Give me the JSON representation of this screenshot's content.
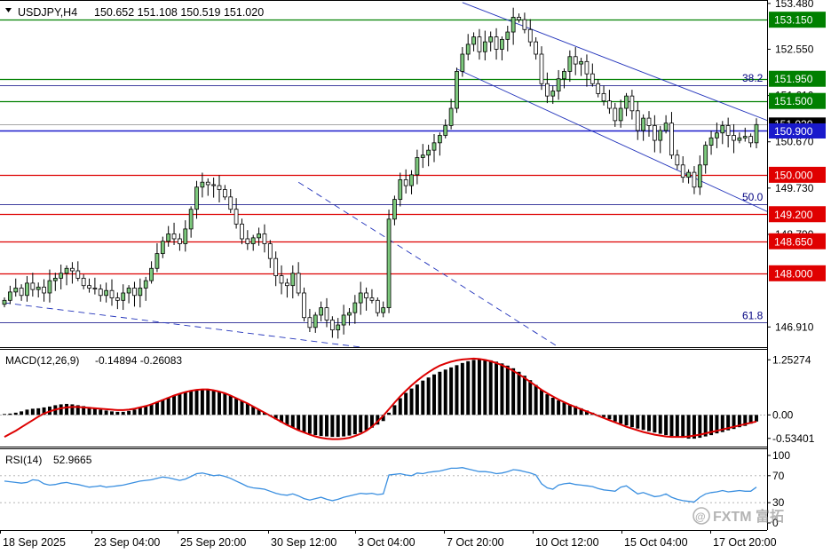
{
  "header": {
    "symbol": "USDJPY,H4",
    "ohlc": "150.652 151.108 150.519 151.020"
  },
  "macd_header": {
    "label": "MACD(12,26,9)",
    "values": "-0.14894 -0.26083"
  },
  "rsi_header": {
    "label": "RSI(14)",
    "value": "52.9665"
  },
  "watermark": "FXTM 富拓",
  "colors": {
    "candle_up_body": "#7dc97d",
    "candle_down_body": "#ffffff",
    "candle_outline": "#000000",
    "support_line": "#dd0000",
    "resistance_line": "#008000",
    "fib_line": "#000080",
    "channel": "#2233bb",
    "macd_signal": "#dd0000",
    "rsi_line": "#3a8fe0",
    "current_price": "#1a1acc"
  },
  "chart_data": [
    {
      "type": "candlestick",
      "title": "USDJPY,H4",
      "ylim": [
        146.5,
        153.55
      ],
      "y_axis_ticks": [
        "153.480",
        "152.550",
        "151.610",
        "150.670",
        "149.730",
        "148.790",
        "146.910"
      ],
      "x_axis_ticks": [
        "18 Sep 2025",
        "23 Sep 04:00",
        "25 Sep 20:00",
        "30 Sep 12:00",
        "3 Oct 04:00",
        "7 Oct 20:00",
        "10 Oct 12:00",
        "15 Oct 04:00",
        "17 Oct 20:00"
      ],
      "closes": [
        147.45,
        147.62,
        147.7,
        147.55,
        147.8,
        147.67,
        147.72,
        147.6,
        147.85,
        147.9,
        148.0,
        148.1,
        148.05,
        147.9,
        147.75,
        147.7,
        147.68,
        147.55,
        147.65,
        147.5,
        147.45,
        147.6,
        147.7,
        147.55,
        147.7,
        147.85,
        148.1,
        148.4,
        148.65,
        148.8,
        148.7,
        148.6,
        148.9,
        149.3,
        149.75,
        149.85,
        149.8,
        149.78,
        149.7,
        149.55,
        149.3,
        149.0,
        148.7,
        148.6,
        148.72,
        148.8,
        148.6,
        148.3,
        147.95,
        147.8,
        147.75,
        148.0,
        147.6,
        147.1,
        146.9,
        147.15,
        147.3,
        147.05,
        146.85,
        146.95,
        147.15,
        147.2,
        147.4,
        147.6,
        147.5,
        147.45,
        147.2,
        147.3,
        149.1,
        149.5,
        149.9,
        149.78,
        150.0,
        150.35,
        150.4,
        150.5,
        150.65,
        150.8,
        151.0,
        151.35,
        152.1,
        152.45,
        152.65,
        152.8,
        152.5,
        152.7,
        152.8,
        152.55,
        152.75,
        152.9,
        153.2,
        153.15,
        152.95,
        152.7,
        152.45,
        151.85,
        151.6,
        151.7,
        151.95,
        152.1,
        152.4,
        152.25,
        152.3,
        152.05,
        151.85,
        151.65,
        151.5,
        151.35,
        151.1,
        151.35,
        151.6,
        151.3,
        150.9,
        151.15,
        151.0,
        150.7,
        150.9,
        151.05,
        150.4,
        150.2,
        149.95,
        150.05,
        149.75,
        150.2,
        150.6,
        150.75,
        150.85,
        151.0,
        150.8,
        150.7,
        150.75,
        150.78,
        150.65,
        151.02
      ]
    },
    {
      "type": "bar",
      "title": "MACD(12,26,9)",
      "values": [
        0.02,
        0.03,
        0.05,
        0.08,
        0.12,
        0.14,
        0.15,
        0.17,
        0.19,
        0.22,
        0.24,
        0.25,
        0.24,
        0.22,
        0.2,
        0.18,
        0.15,
        0.12,
        0.1,
        0.08,
        0.07,
        0.07,
        0.09,
        0.12,
        0.16,
        0.2,
        0.25,
        0.3,
        0.35,
        0.4,
        0.44,
        0.48,
        0.52,
        0.55,
        0.57,
        0.58,
        0.58,
        0.56,
        0.53,
        0.49,
        0.44,
        0.38,
        0.32,
        0.26,
        0.19,
        0.12,
        0.05,
        -0.02,
        -0.1,
        -0.17,
        -0.23,
        -0.29,
        -0.34,
        -0.39,
        -0.43,
        -0.46,
        -0.48,
        -0.49,
        -0.5,
        -0.5,
        -0.49,
        -0.47,
        -0.44,
        -0.4,
        -0.35,
        -0.29,
        -0.22,
        -0.14,
        0.05,
        0.22,
        0.38,
        0.5,
        0.6,
        0.69,
        0.78,
        0.85,
        0.92,
        0.98,
        1.03,
        1.08,
        1.13,
        1.18,
        1.22,
        1.25,
        1.26,
        1.26,
        1.24,
        1.21,
        1.17,
        1.12,
        1.06,
        0.98,
        0.89,
        0.79,
        0.68,
        0.57,
        0.47,
        0.39,
        0.33,
        0.28,
        0.24,
        0.2,
        0.15,
        0.1,
        0.05,
        0.0,
        -0.05,
        -0.1,
        -0.15,
        -0.2,
        -0.24,
        -0.28,
        -0.31,
        -0.34,
        -0.37,
        -0.4,
        -0.43,
        -0.46,
        -0.48,
        -0.5,
        -0.52,
        -0.54,
        -0.54,
        -0.52,
        -0.49,
        -0.46,
        -0.42,
        -0.39,
        -0.35,
        -0.32,
        -0.28,
        -0.25,
        -0.2,
        -0.15
      ],
      "signal": [
        -0.5,
        -0.43,
        -0.36,
        -0.28,
        -0.2,
        -0.12,
        -0.04,
        0.03,
        0.08,
        0.12,
        0.15,
        0.17,
        0.18,
        0.18,
        0.17,
        0.16,
        0.15,
        0.14,
        0.13,
        0.12,
        0.11,
        0.11,
        0.12,
        0.14,
        0.17,
        0.2,
        0.24,
        0.29,
        0.34,
        0.39,
        0.44,
        0.48,
        0.52,
        0.55,
        0.57,
        0.58,
        0.58,
        0.56,
        0.53,
        0.49,
        0.44,
        0.38,
        0.32,
        0.26,
        0.19,
        0.12,
        0.05,
        -0.02,
        -0.09,
        -0.16,
        -0.23,
        -0.29,
        -0.35,
        -0.4,
        -0.45,
        -0.49,
        -0.52,
        -0.54,
        -0.55,
        -0.55,
        -0.54,
        -0.52,
        -0.48,
        -0.43,
        -0.36,
        -0.27,
        -0.15,
        -0.02,
        0.13,
        0.28,
        0.42,
        0.55,
        0.67,
        0.78,
        0.88,
        0.97,
        1.05,
        1.12,
        1.17,
        1.21,
        1.24,
        1.26,
        1.27,
        1.28,
        1.27,
        1.25,
        1.22,
        1.18,
        1.13,
        1.07,
        1.0,
        0.92,
        0.84,
        0.75,
        0.66,
        0.57,
        0.49,
        0.42,
        0.35,
        0.29,
        0.23,
        0.18,
        0.13,
        0.08,
        0.03,
        -0.02,
        -0.07,
        -0.12,
        -0.17,
        -0.22,
        -0.27,
        -0.31,
        -0.35,
        -0.39,
        -0.42,
        -0.45,
        -0.47,
        -0.49,
        -0.5,
        -0.5,
        -0.5,
        -0.49,
        -0.47,
        -0.45,
        -0.42,
        -0.39,
        -0.36,
        -0.33,
        -0.3,
        -0.27,
        -0.24,
        -0.21,
        -0.18,
        -0.15
      ],
      "ylim": [
        -0.72,
        1.5
      ],
      "y_axis_ticks": [
        "1.25274",
        "0.00",
        "-0.53401"
      ]
    },
    {
      "type": "line",
      "title": "RSI(14)",
      "values": [
        62,
        61,
        60,
        59,
        60,
        64,
        63,
        58,
        56,
        57,
        59,
        60,
        58,
        57,
        55,
        53,
        54,
        55,
        53,
        54,
        55,
        56,
        58,
        60,
        62,
        63,
        64,
        66,
        68,
        67,
        65,
        63,
        65,
        69,
        73,
        74,
        72,
        70,
        71,
        69,
        66,
        62,
        58,
        54,
        52,
        51,
        50,
        47,
        44,
        42,
        41,
        43,
        40,
        36,
        34,
        36,
        38,
        35,
        33,
        35,
        38,
        40,
        42,
        44,
        43,
        44,
        42,
        43,
        71,
        72,
        73,
        71,
        70,
        74,
        73,
        75,
        76,
        77,
        79,
        81,
        81,
        82,
        80,
        78,
        76,
        76,
        75,
        73,
        74,
        76,
        79,
        78,
        76,
        74,
        71,
        58,
        52,
        50,
        56,
        58,
        59,
        57,
        56,
        55,
        54,
        51,
        49,
        48,
        47,
        53,
        55,
        49,
        43,
        45,
        42,
        39,
        40,
        43,
        38,
        35,
        33,
        32,
        31,
        38,
        43,
        45,
        46,
        48,
        46,
        47,
        48,
        47,
        47,
        53
      ],
      "ylim": [
        0,
        100
      ],
      "y_axis_ticks": [
        "100",
        "70",
        "30",
        "0"
      ]
    }
  ],
  "annotations": {
    "price_labels": [
      {
        "text": "153.150",
        "kind": "resistance",
        "value": 153.15
      },
      {
        "text": "151.950",
        "kind": "resistance",
        "value": 151.95
      },
      {
        "text": "151.500",
        "kind": "resistance",
        "value": 151.5
      },
      {
        "text": "150.900",
        "kind": "current",
        "value": 150.9
      },
      {
        "text": "150.000",
        "kind": "support",
        "value": 150.0
      },
      {
        "text": "149.200",
        "kind": "support",
        "value": 149.2
      },
      {
        "text": "148.650",
        "kind": "support",
        "value": 148.65
      },
      {
        "text": "148.000",
        "kind": "support",
        "value": 148.0
      }
    ],
    "fib_labels": [
      {
        "text": "38.2",
        "value": 151.82
      },
      {
        "text": "50.0",
        "value": 149.4
      },
      {
        "text": "61.8",
        "value": 147.0
      }
    ],
    "current_price_label": "151.020"
  }
}
